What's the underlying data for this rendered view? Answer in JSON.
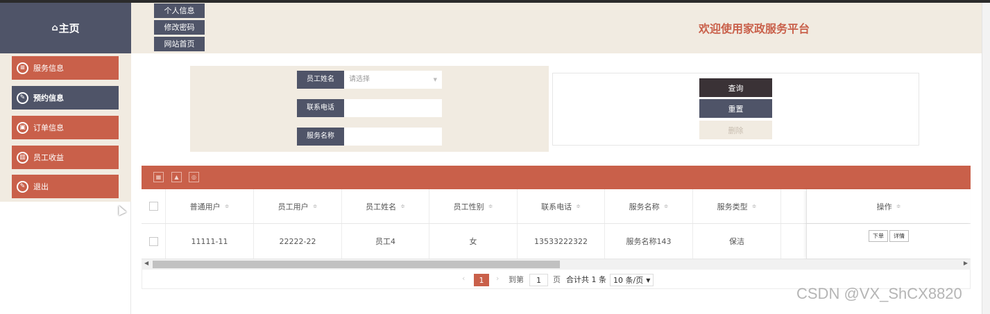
{
  "header": {
    "home_label": "主页",
    "home_icon": "home-icon",
    "nav": [
      "个人信息",
      "修改密码",
      "网站首页"
    ],
    "welcome": "欢迎使用家政服务平台"
  },
  "sidebar": {
    "items": [
      {
        "label": "服务信息",
        "icon": "document-icon",
        "glyph": "≡",
        "active": false
      },
      {
        "label": "预约信息",
        "icon": "edit-icon",
        "glyph": "✎",
        "active": true
      },
      {
        "label": "订单信息",
        "icon": "cart-icon",
        "glyph": "▣",
        "active": false
      },
      {
        "label": "员工收益",
        "icon": "bar-chart-icon",
        "glyph": "▥",
        "active": false
      },
      {
        "label": "退出",
        "icon": "edit-icon",
        "glyph": "✎",
        "active": false
      }
    ]
  },
  "search": {
    "fields": [
      {
        "label": "员工姓名",
        "value": "",
        "placeholder": "请选择",
        "type": "select"
      },
      {
        "label": "联系电话",
        "value": "",
        "placeholder": ""
      },
      {
        "label": "服务名称",
        "value": "",
        "placeholder": ""
      }
    ],
    "buttons": {
      "query": "查询",
      "reset": "重置",
      "delete": "删除"
    }
  },
  "toolbar": {
    "icons": [
      "export-excel-icon",
      "print-icon",
      "settings-icon"
    ]
  },
  "table": {
    "columns": [
      "普通用户",
      "员工用户",
      "员工姓名",
      "员工性别",
      "联系电话",
      "服务名称",
      "服务类型",
      "操作"
    ],
    "rows": [
      {
        "cells": [
          "11111-11",
          "22222-22",
          "员工4",
          "女",
          "13533222322",
          "服务名称143",
          "保洁"
        ],
        "actions": [
          "下单",
          "详情"
        ]
      }
    ]
  },
  "pagination": {
    "prev": "‹",
    "current": "1",
    "next": "›",
    "goto_prefix": "到第",
    "goto_value": "1",
    "goto_suffix": "页",
    "total": "合计共 1 条",
    "page_size": "10 条/页"
  },
  "watermark": "CSDN @VX_ShCX8820",
  "colors": {
    "accent": "#c9604a",
    "dark": "#4f5468",
    "beige": "#f1ebe1",
    "black_btn": "#3a3236"
  }
}
